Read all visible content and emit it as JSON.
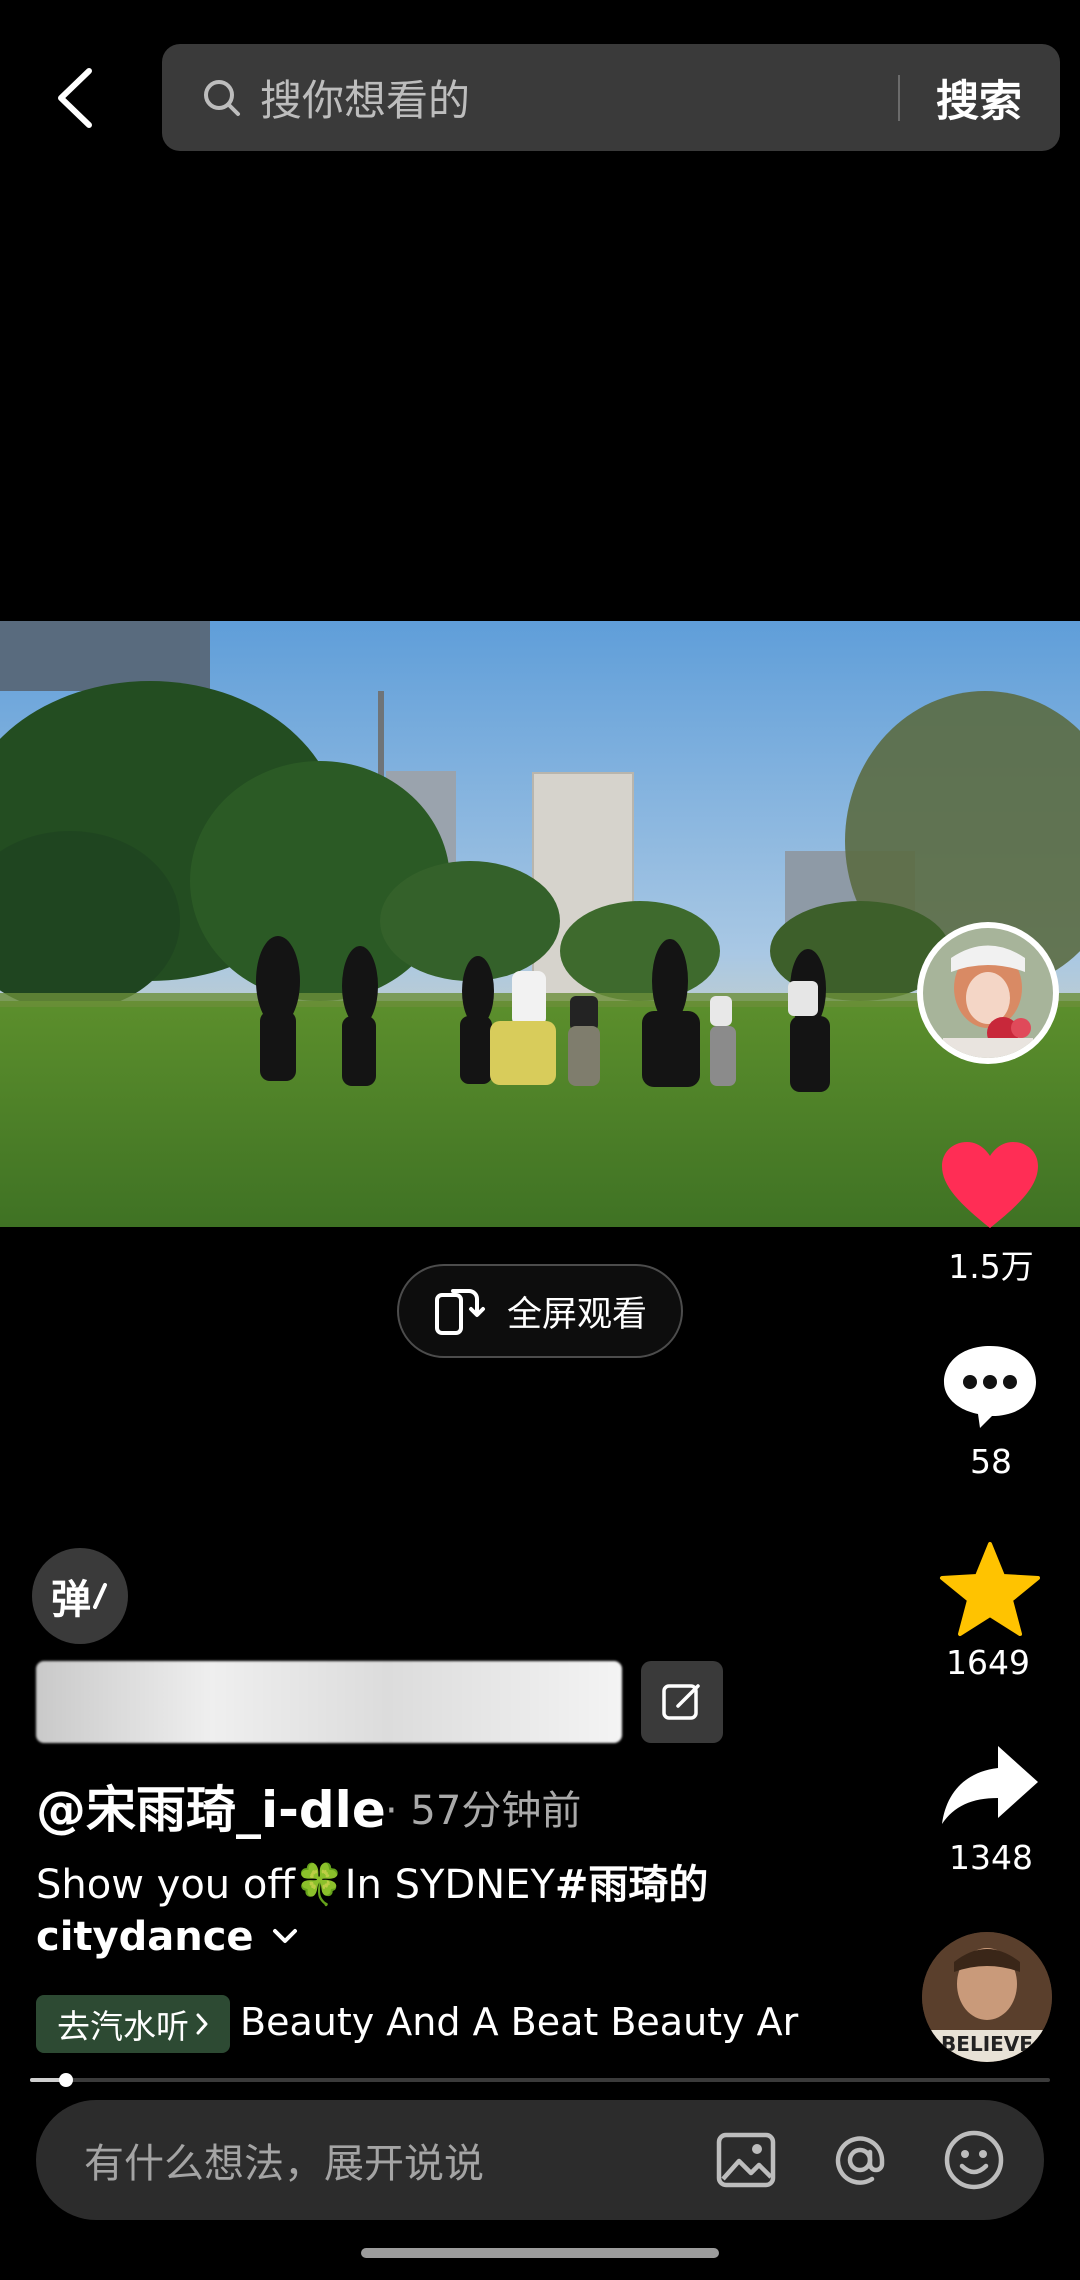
{
  "header": {
    "back_icon": "chevron-left-icon",
    "search_placeholder": "搜你想看的",
    "search_button": "搜索"
  },
  "player": {
    "fullscreen_label": "全屏观看"
  },
  "actions": {
    "like_count": "1.5万",
    "comment_count": "58",
    "favorite_count": "1649",
    "share_count": "1348",
    "like_color": "#ff2d55",
    "favorite_color": "#ffc300"
  },
  "danmaku": {
    "toggle_label": "弹"
  },
  "post": {
    "author": "@宋雨琦_i-dle",
    "time": "· 57分钟前",
    "caption_text": "Show you off",
    "caption_emoji": "🍀",
    "caption_text2": "In SYDNEY",
    "hashtag": "#雨琦的",
    "hashtag_cont": "citydance"
  },
  "music": {
    "tag": "去汽水听",
    "track": "Beauty And A Beat    Beauty Ar",
    "disc_text": "BELIEVE",
    "tag_color": "#2d4a33"
  },
  "progress": {
    "fraction": 0.035
  },
  "comment": {
    "placeholder": "有什么想法，展开说说"
  }
}
